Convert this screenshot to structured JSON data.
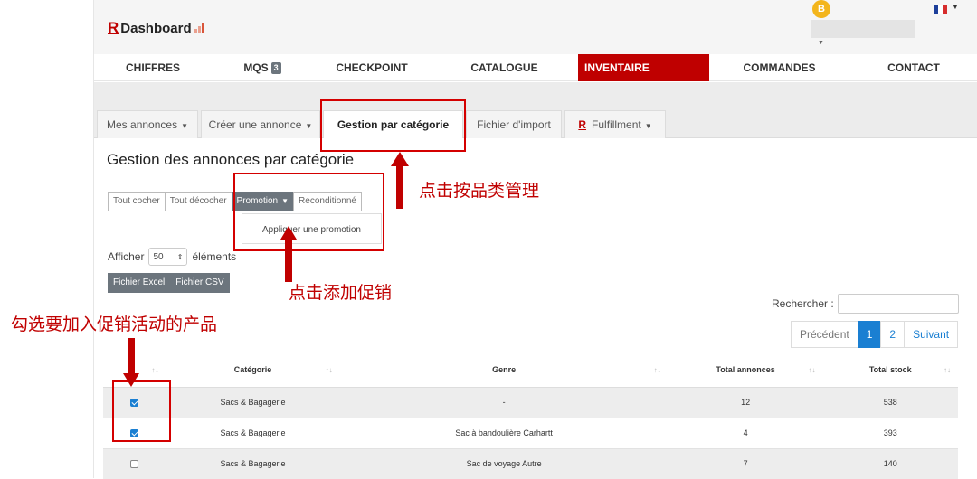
{
  "header": {
    "logo_letter": "R",
    "logo_text": "Dashboard",
    "avatar_initial": "B",
    "colors": {
      "brand": "#bf0000",
      "avatar": "#f3b51c"
    }
  },
  "main_nav": {
    "items": [
      {
        "label": "CHIFFRES"
      },
      {
        "label": "MQS",
        "badge": "3"
      },
      {
        "label": "CHECKPOINT"
      },
      {
        "label": "CATALOGUE"
      },
      {
        "label": "INVENTAIRE",
        "active": true
      },
      {
        "label": "COMMANDES"
      },
      {
        "label": "CONTACT"
      }
    ]
  },
  "tabs": {
    "mes_annonces": "Mes annonces",
    "creer_annonce": "Créer une annonce",
    "gestion_categorie": "Gestion par catégorie",
    "fichier_import": "Fichier d'import",
    "fulfillment_r": "R",
    "fulfillment": "Fulfillment"
  },
  "page": {
    "title": "Gestion des annonces par catégorie"
  },
  "toolbar": {
    "tout_cocher": "Tout cocher",
    "tout_decocher": "Tout décocher",
    "promotion": "Promotion",
    "reconditionne": "Reconditionné",
    "dropdown_item": "Appliquer une promotion"
  },
  "entries": {
    "prefix": "Afficher",
    "value": "50",
    "suffix": "éléments"
  },
  "export": {
    "excel": "Fichier Excel",
    "csv": "Fichier CSV"
  },
  "search": {
    "label": "Rechercher :"
  },
  "pagination": {
    "prev": "Précédent",
    "page1": "1",
    "page2": "2",
    "next": "Suivant"
  },
  "table": {
    "headers": [
      "",
      "Catégorie",
      "Genre",
      "Total annonces",
      "Total stock"
    ],
    "rows": [
      {
        "checked": true,
        "categorie": "Sacs & Bagagerie",
        "genre": "-",
        "total_annonces": "12",
        "total_stock": "538"
      },
      {
        "checked": true,
        "categorie": "Sacs & Bagagerie",
        "genre": "Sac à bandoulière Carhartt",
        "total_annonces": "4",
        "total_stock": "393"
      },
      {
        "checked": false,
        "categorie": "Sacs & Bagagerie",
        "genre": "Sac de voyage Autre",
        "total_annonces": "7",
        "total_stock": "140"
      }
    ]
  },
  "annotations": {
    "click_category": "点击按品类管理",
    "click_promotion": "点击添加促销",
    "select_products": "勾选要加入促销活动的产品",
    "color": "#c00000"
  }
}
